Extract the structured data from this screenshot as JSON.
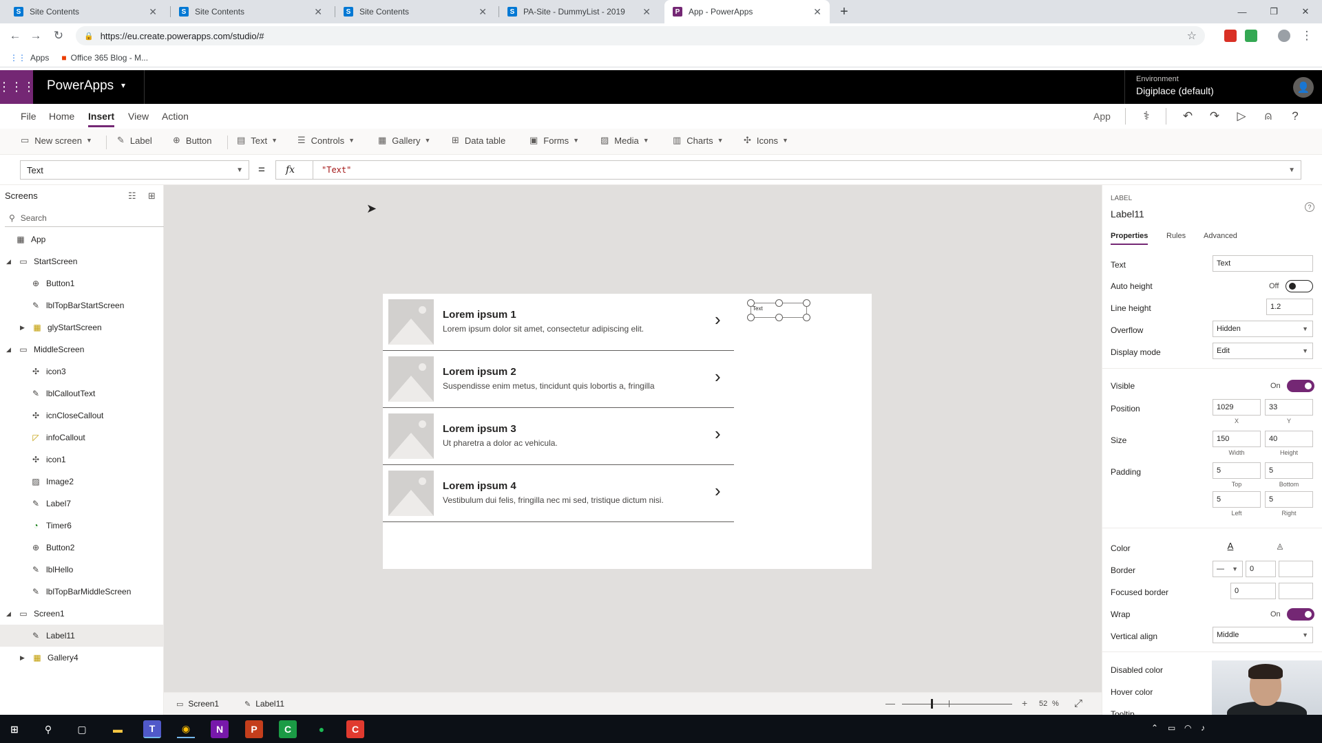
{
  "browser": {
    "tabs": [
      {
        "title": "Site Contents",
        "favicon": "S"
      },
      {
        "title": "Site Contents",
        "favicon": "S"
      },
      {
        "title": "Site Contents",
        "favicon": "S"
      },
      {
        "title": "PA-Site - DummyList - 2019",
        "favicon": "S"
      },
      {
        "title": "App - PowerApps",
        "favicon": "P"
      }
    ],
    "url": "https://eu.create.powerapps.com/studio/#",
    "bookmarks": [
      {
        "label": "Apps"
      },
      {
        "label": "Office 365 Blog - M..."
      }
    ]
  },
  "app": {
    "brand": "PowerApps",
    "environment_label": "Environment",
    "environment_value": "Digiplace (default)"
  },
  "ribbon": {
    "menus": [
      "File",
      "Home",
      "Insert",
      "View",
      "Action"
    ],
    "active_menu": "Insert",
    "app_label": "App"
  },
  "toolbar": {
    "items": [
      {
        "label": "New screen"
      },
      {
        "label": "Label"
      },
      {
        "label": "Button"
      },
      {
        "label": "Text"
      },
      {
        "label": "Controls"
      },
      {
        "label": "Gallery"
      },
      {
        "label": "Data table"
      },
      {
        "label": "Forms"
      },
      {
        "label": "Media"
      },
      {
        "label": "Charts"
      },
      {
        "label": "Icons"
      }
    ]
  },
  "formula": {
    "property": "Text",
    "equals": "=",
    "fx": "fx",
    "value": "\"Text\""
  },
  "tree": {
    "title": "Screens",
    "search_placeholder": "Search",
    "nodes": [
      {
        "label": "App"
      },
      {
        "label": "StartScreen"
      },
      {
        "label": "Button1"
      },
      {
        "label": "lblTopBarStartScreen"
      },
      {
        "label": "glyStartScreen"
      },
      {
        "label": "MiddleScreen"
      },
      {
        "label": "icon3"
      },
      {
        "label": "lblCalloutText"
      },
      {
        "label": "icnCloseCallout"
      },
      {
        "label": "infoCallout"
      },
      {
        "label": "icon1"
      },
      {
        "label": "Image2"
      },
      {
        "label": "Label7"
      },
      {
        "label": "Timer6"
      },
      {
        "label": "Button2"
      },
      {
        "label": "lblHello"
      },
      {
        "label": "lblTopBarMiddleScreen"
      },
      {
        "label": "Screen1"
      },
      {
        "label": "Label11"
      },
      {
        "label": "Gallery4"
      }
    ],
    "selected": "Label11"
  },
  "canvas": {
    "gallery_items": [
      {
        "title": "Lorem ipsum 1",
        "subtitle": "Lorem ipsum dolor sit amet, consectetur adipiscing elit."
      },
      {
        "title": "Lorem ipsum 2",
        "subtitle": "Suspendisse enim metus, tincidunt quis lobortis a, fringilla"
      },
      {
        "title": "Lorem ipsum 3",
        "subtitle": "Ut pharetra a dolor ac vehicula."
      },
      {
        "title": "Lorem ipsum 4",
        "subtitle": "Vestibulum dui felis, fringilla nec mi sed, tristique dictum nisi."
      }
    ],
    "selected_label_text": "Text"
  },
  "statusbar": {
    "screen_crumb": "Screen1",
    "control_crumb": "Label11",
    "zoom": "52",
    "zoom_unit": "%"
  },
  "properties": {
    "control_type": "LABEL",
    "control_name": "Label11",
    "tabs": [
      "Properties",
      "Rules",
      "Advanced"
    ],
    "active_tab": "Properties",
    "text_label": "Text",
    "text_value": "Text",
    "auto_height_label": "Auto height",
    "auto_height_state": "Off",
    "line_height_label": "Line height",
    "line_height_value": "1.2",
    "overflow_label": "Overflow",
    "overflow_value": "Hidden",
    "display_mode_label": "Display mode",
    "display_mode_value": "Edit",
    "visible_label": "Visible",
    "visible_state": "On",
    "position_label": "Position",
    "position_x": "1029",
    "position_y": "33",
    "x_caption": "X",
    "y_caption": "Y",
    "size_label": "Size",
    "size_width": "150",
    "size_height": "40",
    "width_caption": "Width",
    "height_caption": "Height",
    "padding_label": "Padding",
    "padding_top": "5",
    "padding_bottom": "5",
    "padding_left": "5",
    "padding_right": "5",
    "top_caption": "Top",
    "bottom_caption": "Bottom",
    "left_caption": "Left",
    "right_caption": "Right",
    "color_label": "Color",
    "border_label": "Border",
    "border_value": "0",
    "focused_border_label": "Focused border",
    "focused_border_value": "0",
    "wrap_label": "Wrap",
    "wrap_state": "On",
    "vertical_align_label": "Vertical align",
    "vertical_align_value": "Middle",
    "disabled_color_label": "Disabled color",
    "hover_color_label": "Hover color",
    "tooltip_label": "Tooltip"
  },
  "colors": {
    "accent": "#742774",
    "header": "#000000",
    "canvas_bg": "#e1dfdd"
  }
}
